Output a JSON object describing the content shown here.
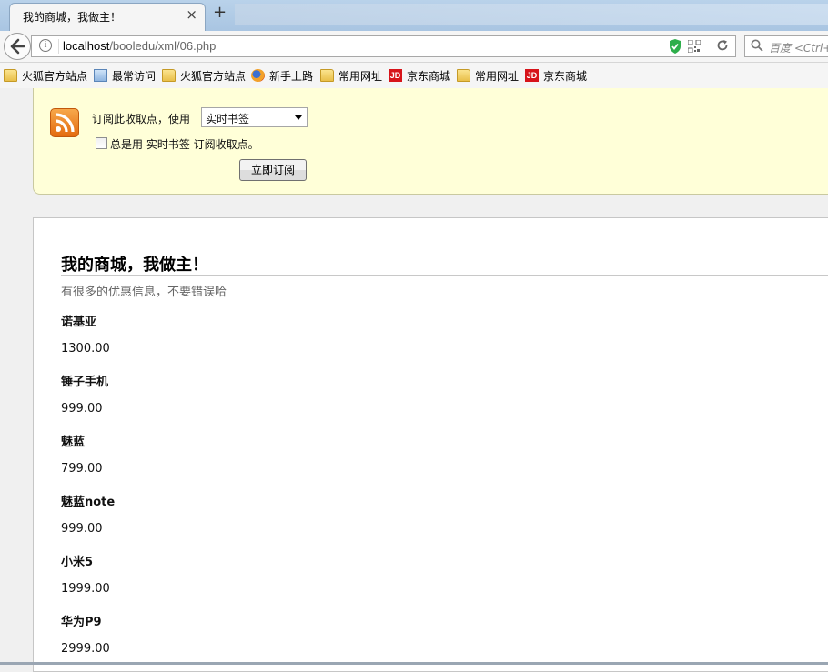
{
  "tab": {
    "title": "我的商城，我做主！",
    "close": "×",
    "new_tab": "+"
  },
  "nav": {
    "url_host": "localhost",
    "url_path": "/booledu/xml/06.php",
    "search_placeholder": "百度 <Ctrl+K>"
  },
  "bookmarks": [
    {
      "label": "火狐官方站点",
      "icon": "folder-icon"
    },
    {
      "label": "最常访问",
      "icon": "page-icon"
    },
    {
      "label": "火狐官方站点",
      "icon": "folder-icon"
    },
    {
      "label": "新手上路",
      "icon": "firefox-icon"
    },
    {
      "label": "常用网址",
      "icon": "folder-icon"
    },
    {
      "label": "京东商城",
      "icon": "jd-icon"
    },
    {
      "label": "常用网址",
      "icon": "folder-icon"
    },
    {
      "label": "京东商城",
      "icon": "jd-icon"
    }
  ],
  "jd_icon_text": "JD",
  "subscribe": {
    "label": "订阅此收取点，使用",
    "selected": "实时书签",
    "always_label": "总是用 实时书签 订阅收取点。",
    "always_checked": false,
    "button": "立即订阅"
  },
  "feed": {
    "title": "我的商城，我做主！",
    "subtitle": "有很多的优惠信息，不要错误哈",
    "items": [
      {
        "name": "诺基亚",
        "price": "1300.00"
      },
      {
        "name": "锤子手机",
        "price": "999.00"
      },
      {
        "name": "魅蓝",
        "price": "799.00"
      },
      {
        "name": "魅蓝note",
        "price": "999.00"
      },
      {
        "name": "小米5",
        "price": "1999.00"
      },
      {
        "name": "华为P9",
        "price": "2999.00"
      }
    ]
  },
  "colors": {
    "feed_background": "#ffffd8",
    "rss_orange": "#e36b0f",
    "jd_red": "#d7141a"
  }
}
